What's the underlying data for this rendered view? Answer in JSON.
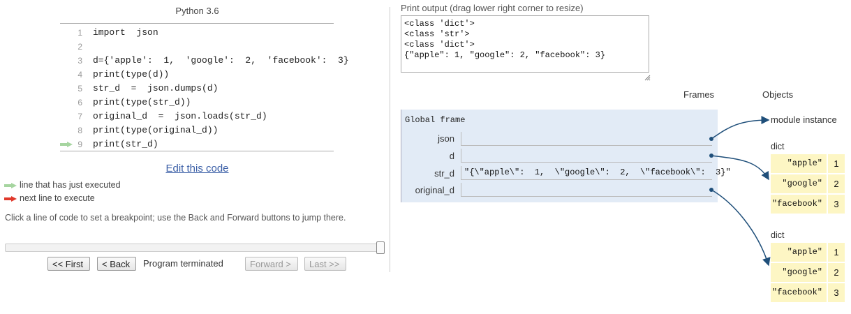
{
  "language": "Python 3.6",
  "code_lines": [
    {
      "num": "1",
      "text": "import  json"
    },
    {
      "num": "2",
      "text": ""
    },
    {
      "num": "3",
      "text": "d={'apple':  1,  'google':  2,  'facebook':  3}"
    },
    {
      "num": "4",
      "text": "print(type(d))"
    },
    {
      "num": "5",
      "text": "str_d  =  json.dumps(d)"
    },
    {
      "num": "6",
      "text": "print(type(str_d))"
    },
    {
      "num": "7",
      "text": "original_d  =  json.loads(str_d)"
    },
    {
      "num": "8",
      "text": "print(type(original_d))"
    },
    {
      "num": "9",
      "text": "print(str_d)"
    }
  ],
  "edit_link": "Edit this code",
  "legend": {
    "just_executed": "line that has just executed",
    "next_line": "next line to execute"
  },
  "help_text": "Click a line of code to set a breakpoint; use the Back and Forward buttons to jump there.",
  "nav": {
    "first": "<< First",
    "back": "< Back",
    "status": "Program terminated",
    "forward": "Forward >",
    "last": "Last >>"
  },
  "print_output": {
    "label": "Print output (drag lower right corner to resize)",
    "lines": [
      "<class 'dict'>",
      "<class 'str'>",
      "<class 'dict'>",
      "{\"apple\": 1, \"google\": 2, \"facebook\": 3}"
    ]
  },
  "headers": {
    "frames": "Frames",
    "objects": "Objects"
  },
  "frame": {
    "title": "Global frame",
    "vars": [
      {
        "name": "json",
        "value": ""
      },
      {
        "name": "d",
        "value": ""
      },
      {
        "name": "str_d",
        "value": "\"{\\\"apple\\\":  1,  \\\"google\\\":  2,  \\\"facebook\\\":  3}\""
      },
      {
        "name": "original_d",
        "value": ""
      }
    ]
  },
  "objects": {
    "module_label": "module instance",
    "dicts": [
      {
        "label": "dict",
        "entries": [
          {
            "key": "\"apple\"",
            "value": "1"
          },
          {
            "key": "\"google\"",
            "value": "2"
          },
          {
            "key": "\"facebook\"",
            "value": "3"
          }
        ]
      },
      {
        "label": "dict",
        "entries": [
          {
            "key": "\"apple\"",
            "value": "1"
          },
          {
            "key": "\"google\"",
            "value": "2"
          },
          {
            "key": "\"facebook\"",
            "value": "3"
          }
        ]
      }
    ]
  },
  "colors": {
    "just_executed_arrow": "#a6d5a0",
    "next_line_arrow": "#e0392b",
    "frame_bg": "#e2ebf6",
    "dict_bg": "#fdf6c4",
    "pointer": "#1f4f7a",
    "link": "#3b5fa7"
  }
}
